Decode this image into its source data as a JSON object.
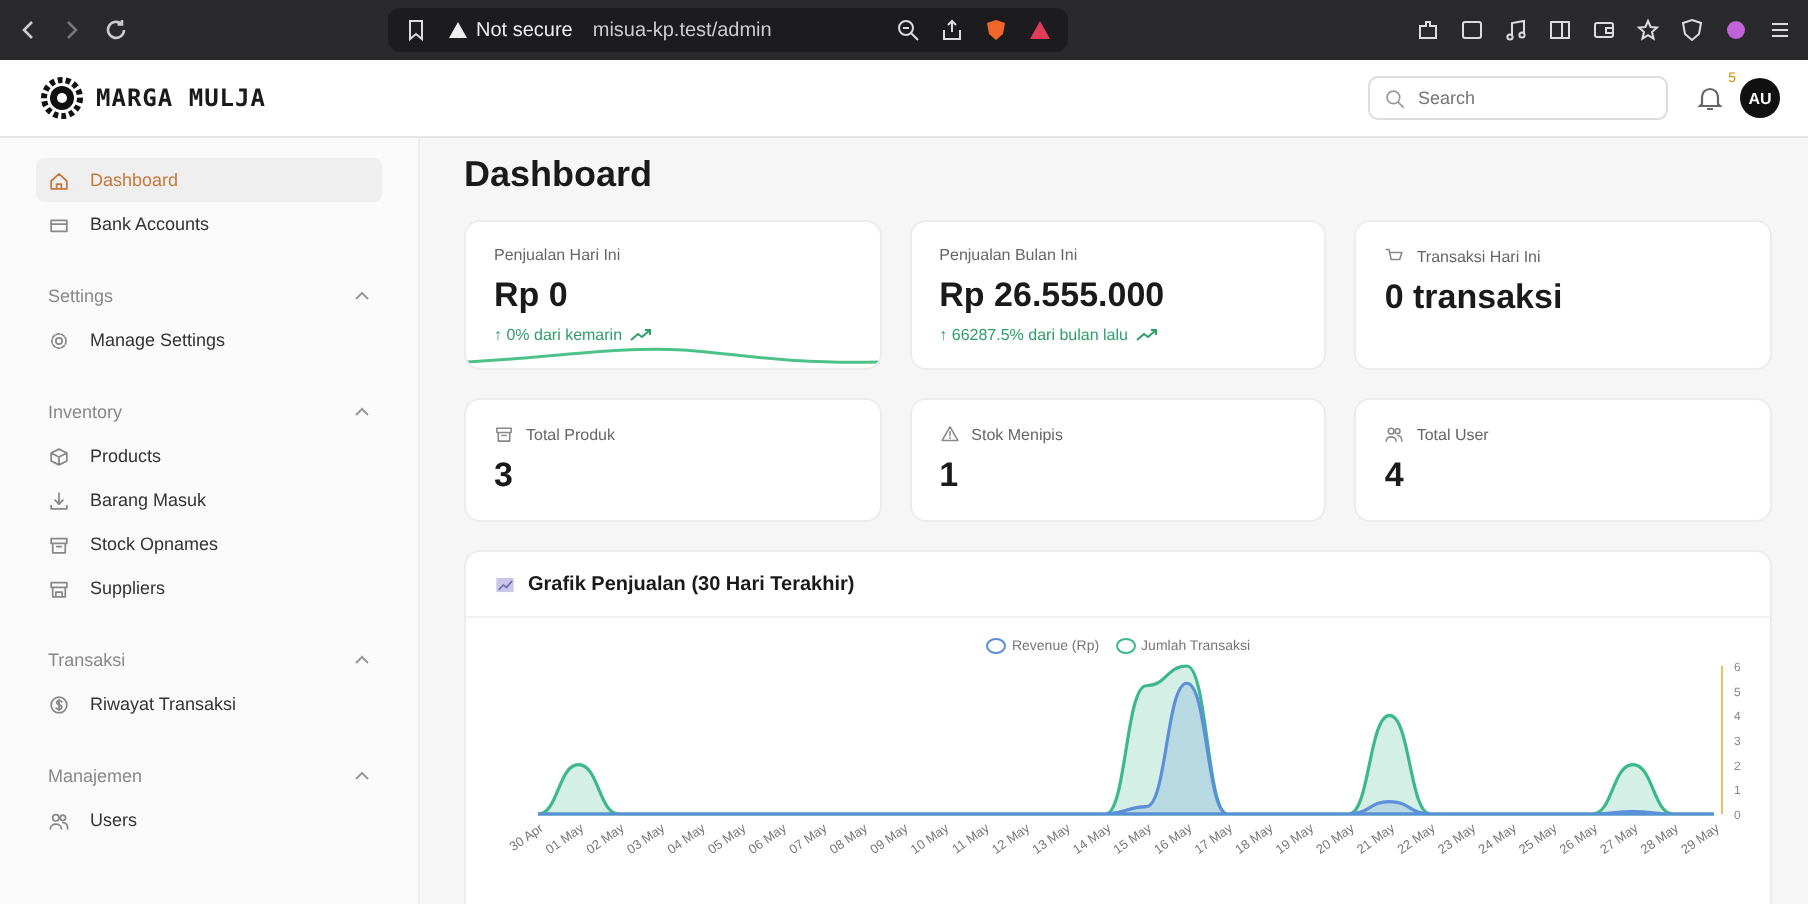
{
  "browser": {
    "security": "Not secure",
    "url": "misua-kp.test/admin"
  },
  "header": {
    "brand": "MARGA MULJA",
    "search": {
      "placeholder": "Search"
    },
    "notifications": "5",
    "avatar": "AU"
  },
  "sidebar": {
    "items": [
      {
        "label": "Dashboard",
        "selected": true
      },
      {
        "label": "Bank Accounts",
        "selected": false
      }
    ],
    "groups": [
      {
        "title": "Settings",
        "expanded": true,
        "items": [
          {
            "label": "Manage Settings",
            "selected": false
          }
        ]
      },
      {
        "title": "Inventory",
        "expanded": true,
        "items": [
          {
            "label": "Products",
            "selected": false
          },
          {
            "label": "Barang Masuk",
            "selected": false
          },
          {
            "label": "Stock Opnames",
            "selected": false
          },
          {
            "label": "Suppliers",
            "selected": false
          }
        ]
      },
      {
        "title": "Transaksi",
        "expanded": true,
        "items": [
          {
            "label": "Riwayat Transaksi",
            "selected": false
          }
        ]
      },
      {
        "title": "Manajemen",
        "expanded": true,
        "items": [
          {
            "label": "Users",
            "selected": false
          }
        ]
      }
    ]
  },
  "page_title": "Dashboard",
  "stats": [
    {
      "kind": "sparkline",
      "label": "Penjualan Hari Ini",
      "value": "Rp 0",
      "change": "↑ 0% dari kemarin"
    },
    {
      "kind": "trend",
      "label": "Penjualan Bulan Ini",
      "value": "Rp 26.555.000",
      "change": "↑ 66287.5% dari bulan lalu"
    },
    {
      "kind": "icon",
      "label": "Transaksi Hari Ini",
      "value": "0 transaksi"
    },
    {
      "kind": "icon",
      "label": "Total Produk",
      "value": "3"
    },
    {
      "kind": "icon",
      "label": "Stok Menipis",
      "value": "1"
    },
    {
      "kind": "icon",
      "label": "Total User",
      "value": "4"
    }
  ],
  "chart": {
    "title": "Grafik Penjualan (30 Hari Terakhir)",
    "chart_data": {
      "type": "area",
      "categories": [
        "30 Apr",
        "01 May",
        "02 May",
        "03 May",
        "04 May",
        "05 May",
        "06 May",
        "07 May",
        "08 May",
        "09 May",
        "10 May",
        "11 May",
        "12 May",
        "13 May",
        "14 May",
        "15 May",
        "16 May",
        "17 May",
        "18 May",
        "19 May",
        "20 May",
        "21 May",
        "22 May",
        "23 May",
        "24 May",
        "25 May",
        "26 May",
        "27 May",
        "28 May",
        "29 May"
      ],
      "series": [
        {
          "name": "Revenue (Rp)",
          "color": "#5b8fd9",
          "values": [
            0,
            0,
            0,
            0,
            0,
            0,
            0,
            0,
            0,
            0,
            0,
            0,
            0,
            0,
            0,
            0.3,
            5.3,
            0,
            0,
            0,
            0,
            0.5,
            0,
            0,
            0,
            0,
            0,
            0.1,
            0,
            0
          ]
        },
        {
          "name": "Jumlah Transaksi",
          "color": "#3cb88a",
          "values": [
            0,
            2,
            0,
            0,
            0,
            0,
            0,
            0,
            0,
            0,
            0,
            0,
            0,
            0,
            0,
            5.2,
            6,
            0,
            0,
            0,
            0,
            4,
            0,
            0,
            0,
            0,
            0,
            2,
            0,
            0
          ]
        }
      ],
      "ylim": [
        0,
        6
      ],
      "yticks": [
        0,
        1,
        2,
        3,
        4,
        5,
        6
      ]
    }
  }
}
